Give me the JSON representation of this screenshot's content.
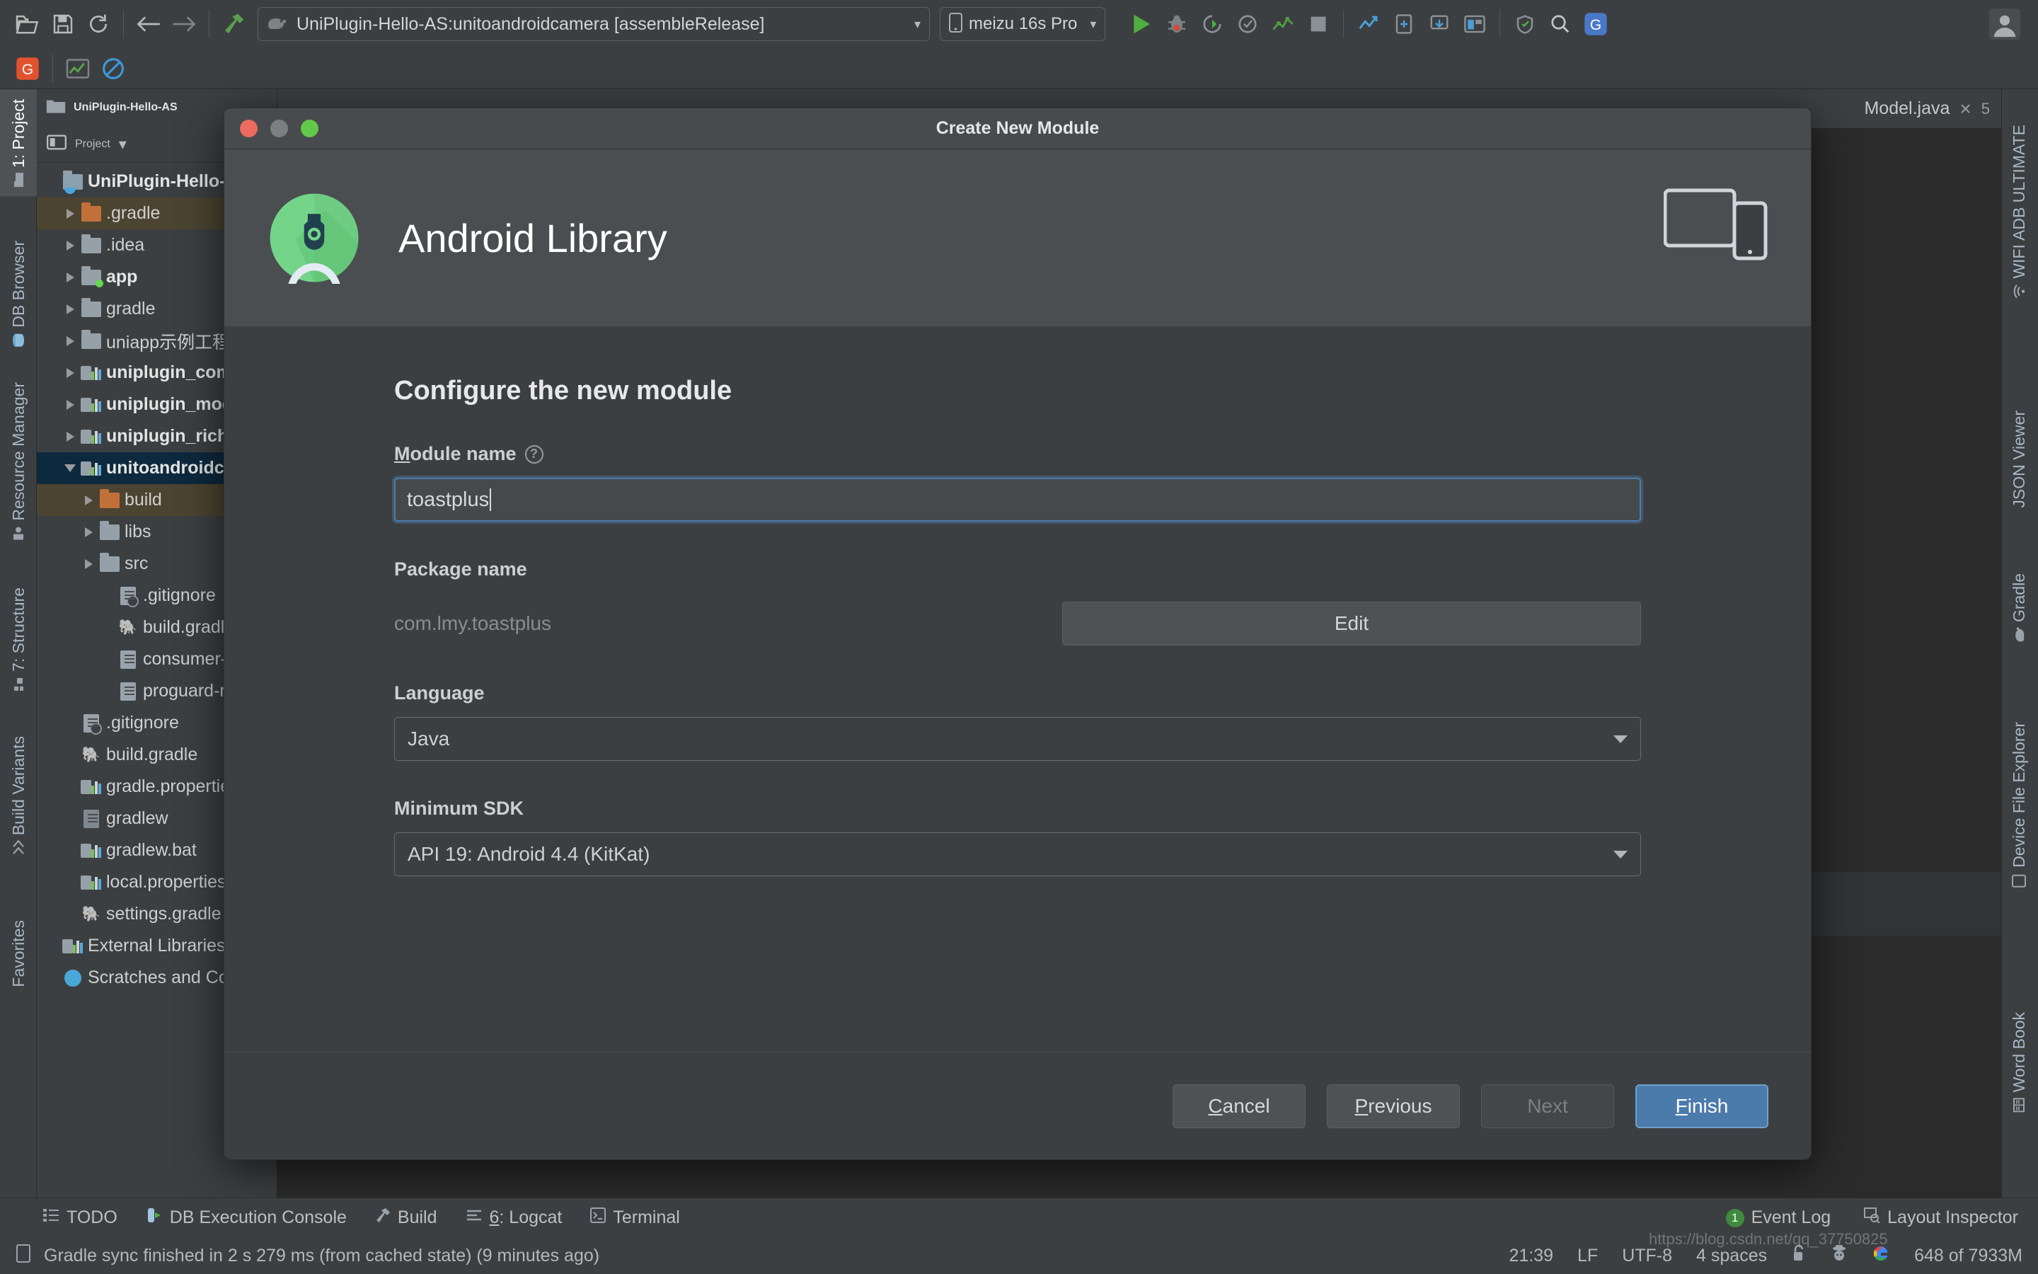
{
  "toolbar": {
    "icons": [
      "open-folder-icon",
      "save-icon",
      "sync-icon",
      "back-arrow-icon",
      "forward-arrow-icon",
      "build-hammer-icon"
    ],
    "run_config": {
      "label": "UniPlugin-Hello-AS:unitoandroidcamera [assembleRelease]",
      "icon": "gradle-elephant-icon",
      "caret": "▾"
    },
    "device_config": {
      "label": "meizu 16s Pro",
      "icon": "phone-icon",
      "caret": "▾"
    },
    "right_icons": [
      "run-icon",
      "debug-icon",
      "attach-debugger-icon",
      "coverage-icon",
      "profiler-icon",
      "stop-icon",
      "sync-project-icon",
      "avd-manager-icon",
      "sdk-manager-icon",
      "layout-inspector-icon",
      "device-manager-icon",
      "search-icon",
      "translate-icon",
      "avatar-icon"
    ]
  },
  "toolbar2": {
    "icons": [
      "google-icon",
      "chart-icon",
      "no-entry-icon"
    ]
  },
  "left_rail": [
    {
      "label": "1: Project",
      "icon": "project-folder-icon",
      "active": true
    },
    {
      "label": "DB Browser",
      "icon": "db-icon",
      "active": false
    },
    {
      "label": "Resource Manager",
      "icon": "resource-icon",
      "active": false
    },
    {
      "label": "7: Structure",
      "icon": "structure-icon",
      "active": false
    },
    {
      "label": "Build Variants",
      "icon": "variants-icon",
      "active": false
    },
    {
      "label": "Favorites",
      "icon": "star-icon",
      "active": false
    }
  ],
  "right_rail": [
    {
      "label": "WIFI ADB ULTIMATE",
      "icon": "wifi-adb-icon"
    },
    {
      "label": "JSON Viewer",
      "icon": "json-icon"
    },
    {
      "label": "Gradle",
      "icon": "gradle-elephant-icon"
    },
    {
      "label": "Device File Explorer",
      "icon": "device-file-icon"
    },
    {
      "label": "Word Book",
      "icon": "book-icon"
    }
  ],
  "project_panel": {
    "window_title": "UniPlugin-Hello-AS",
    "title": "Project",
    "caret": "▾",
    "tree": [
      {
        "label": "UniPlugin-Hello-AS ~/Desktop",
        "depth": 0,
        "arrow": "none",
        "icon": "project-root-icon",
        "bold": true,
        "selected": ""
      },
      {
        "label": ".gradle",
        "depth": 1,
        "arrow": "right",
        "icon": "folder-orange-icon",
        "bold": false,
        "selected": "olive"
      },
      {
        "label": ".idea",
        "depth": 1,
        "arrow": "right",
        "icon": "folder-icon",
        "bold": false,
        "selected": ""
      },
      {
        "label": "app",
        "depth": 1,
        "arrow": "right",
        "icon": "folder-module-icon",
        "bold": true,
        "selected": ""
      },
      {
        "label": "gradle",
        "depth": 1,
        "arrow": "right",
        "icon": "folder-icon",
        "bold": false,
        "selected": ""
      },
      {
        "label": "uniapp示例工程",
        "depth": 1,
        "arrow": "right",
        "icon": "folder-icon",
        "bold": false,
        "selected": ""
      },
      {
        "label": "uniplugin_component",
        "depth": 1,
        "arrow": "right",
        "icon": "module-icon",
        "bold": true,
        "selected": ""
      },
      {
        "label": "uniplugin_module",
        "depth": 1,
        "arrow": "right",
        "icon": "module-icon",
        "bold": true,
        "selected": ""
      },
      {
        "label": "uniplugin_richalert",
        "depth": 1,
        "arrow": "right",
        "icon": "module-icon",
        "bold": true,
        "selected": ""
      },
      {
        "label": "unitoandroidcamera",
        "depth": 1,
        "arrow": "down",
        "icon": "module-icon",
        "bold": true,
        "selected": "blue"
      },
      {
        "label": "build",
        "depth": 2,
        "arrow": "right",
        "icon": "folder-orange-icon",
        "bold": false,
        "selected": "olive"
      },
      {
        "label": "libs",
        "depth": 2,
        "arrow": "right",
        "icon": "folder-icon",
        "bold": false,
        "selected": ""
      },
      {
        "label": "src",
        "depth": 2,
        "arrow": "right",
        "icon": "folder-icon",
        "bold": false,
        "selected": ""
      },
      {
        "label": ".gitignore",
        "depth": 3,
        "arrow": "none",
        "icon": "gitignore-file-icon",
        "bold": false,
        "selected": ""
      },
      {
        "label": "build.gradle",
        "depth": 3,
        "arrow": "none",
        "icon": "gradle-file-icon",
        "bold": false,
        "selected": ""
      },
      {
        "label": "consumer-rules.pro",
        "depth": 3,
        "arrow": "none",
        "icon": "file-icon",
        "bold": false,
        "selected": ""
      },
      {
        "label": "proguard-rules.pro",
        "depth": 3,
        "arrow": "none",
        "icon": "file-icon",
        "bold": false,
        "selected": ""
      },
      {
        "label": ".gitignore",
        "depth": 1,
        "arrow": "none",
        "icon": "gitignore-file-icon",
        "bold": false,
        "selected": ""
      },
      {
        "label": "build.gradle",
        "depth": 1,
        "arrow": "none",
        "icon": "gradle-file-icon",
        "bold": false,
        "selected": ""
      },
      {
        "label": "gradle.properties",
        "depth": 1,
        "arrow": "none",
        "icon": "module-icon",
        "bold": false,
        "selected": ""
      },
      {
        "label": "gradlew",
        "depth": 1,
        "arrow": "none",
        "icon": "script-icon",
        "bold": false,
        "selected": ""
      },
      {
        "label": "gradlew.bat",
        "depth": 1,
        "arrow": "none",
        "icon": "module-icon",
        "bold": false,
        "selected": ""
      },
      {
        "label": "local.properties",
        "depth": 1,
        "arrow": "none",
        "icon": "module-icon",
        "bold": false,
        "selected": ""
      },
      {
        "label": "settings.gradle",
        "depth": 1,
        "arrow": "none",
        "icon": "gradle-file-icon",
        "bold": false,
        "selected": ""
      },
      {
        "label": "External Libraries",
        "depth": 0,
        "arrow": "none",
        "icon": "library-icon",
        "bold": false,
        "selected": ""
      },
      {
        "label": "Scratches and Consoles",
        "depth": 0,
        "arrow": "none",
        "icon": "scratch-icon",
        "bold": false,
        "selected": ""
      }
    ]
  },
  "editor": {
    "tab_label": "Model.java",
    "close_icon": "×",
    "line_badge": "5",
    "pin_icon": "pin-icon",
    "pause_icon": "pause-icon"
  },
  "dialog": {
    "title": "Create New Module",
    "header_title": "Android Library",
    "logo_icon": "android-studio-logo",
    "device_art_icon": "devices-illustration",
    "traffic": {
      "close": "close-window-button",
      "minimize": "minimize-window-button",
      "zoom": "zoom-window-button"
    },
    "section_title": "Configure the new module",
    "fields": {
      "module_name": {
        "label": "Module name",
        "mnemonic": "M",
        "help": "?",
        "value": "toastplus"
      },
      "package_name": {
        "label": "Package name",
        "value": "com.lmy.toastplus",
        "edit_label": "Edit"
      },
      "language": {
        "label": "Language",
        "value": "Java",
        "caret": "▾"
      },
      "min_sdk": {
        "label": "Minimum SDK",
        "value": "API 19: Android 4.4 (KitKat)",
        "caret": "▾"
      }
    },
    "buttons": {
      "cancel": {
        "label": "Cancel",
        "mnemonic": "C"
      },
      "previous": {
        "label": "Previous",
        "mnemonic": "P"
      },
      "next": {
        "label": "Next",
        "disabled": true
      },
      "finish": {
        "label": "Finish",
        "mnemonic": "F",
        "primary": true
      }
    }
  },
  "bottom_bar": {
    "left_items": [
      {
        "label": "TODO",
        "icon": "todo-icon"
      },
      {
        "label": "DB Execution Console",
        "icon": "db-console-icon"
      },
      {
        "label": "Build",
        "icon": "build-hammer-icon"
      },
      {
        "label": "6: Logcat",
        "icon": "logcat-icon",
        "mnemonic": "6"
      },
      {
        "label": "Terminal",
        "icon": "terminal-icon"
      }
    ],
    "right_items": [
      {
        "label": "Event Log",
        "icon": "event-log-icon",
        "badge": "1"
      },
      {
        "label": "Layout Inspector",
        "icon": "layout-inspector-icon"
      }
    ]
  },
  "status_bar": {
    "message": "Gradle sync finished in 2 s 279 ms (from cached state) (9 minutes ago)",
    "message_icon": "status-doc-icon",
    "time": "21:39",
    "line_ending": "LF",
    "encoding": "UTF-8",
    "indent": "4 spaces",
    "lock_icon": "unlock-icon",
    "inspector_icon": "hector-icon",
    "google_icon": "google-icon",
    "memory": "648 of 7933M"
  },
  "watermark": "https://blog.csdn.net/qq_37750825",
  "colors": {
    "accent_blue": "#4b7bab",
    "focus_blue": "#4c7ba8",
    "selection_blue": "#0d293e",
    "selection_olive": "#4b4431",
    "panel_bg": "#3c3f41",
    "editor_bg": "#2b2b2b",
    "dialog_header": "#4b4e50",
    "green": "#62c84a",
    "red": "#ec6a5e"
  }
}
